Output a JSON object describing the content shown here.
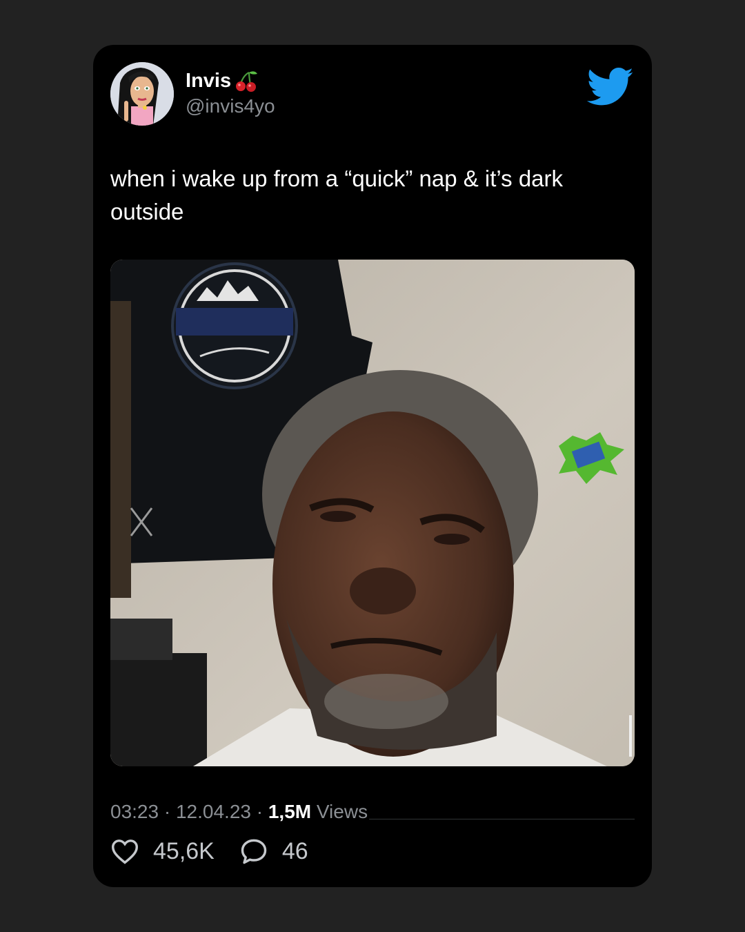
{
  "tweet": {
    "author": {
      "display_name": "Invis",
      "name_emoji_icon": "cherry-icon",
      "handle": "@invis4yo",
      "avatar_icon": "cartoon-avatar"
    },
    "platform_icon": "twitter-bird-icon",
    "text": "when i wake up from a “quick” nap & it’s dark outside",
    "meta": {
      "time": "03:23",
      "separator": " · ",
      "date": "12.04.23",
      "views_count": "1,5M",
      "views_label": "Views"
    },
    "actions": {
      "likes": "45,6K",
      "like_icon": "heart-icon",
      "replies": "46",
      "reply_icon": "comment-icon"
    }
  },
  "colors": {
    "background": "#222222",
    "card": "#000000",
    "twitter_blue": "#1d9bf0",
    "muted_text": "#8b8f94"
  }
}
